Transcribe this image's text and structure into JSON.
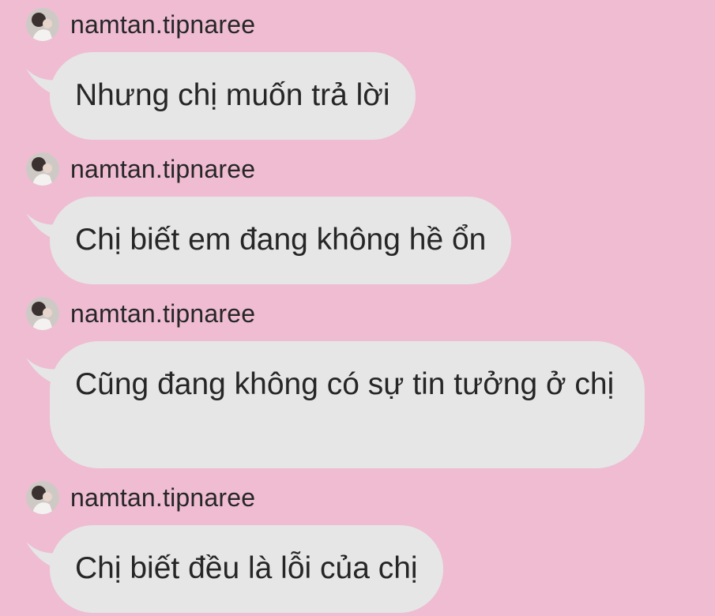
{
  "colors": {
    "background": "#efbcd2",
    "bubble": "#e6e6e6",
    "text": "#262626"
  },
  "messages": [
    {
      "username": "namtan.tipnaree",
      "text": "Nhưng chị muốn trả lời",
      "avatar_icon": "profile-photo-avatar"
    },
    {
      "username": "namtan.tipnaree",
      "text": "Chị biết em đang không hề ổn",
      "avatar_icon": "profile-photo-avatar"
    },
    {
      "username": "namtan.tipnaree",
      "text": "Cũng đang không có sự tin tưởng ở chị",
      "avatar_icon": "profile-photo-avatar"
    },
    {
      "username": "namtan.tipnaree",
      "text": "Chị biết đều là lỗi của chị",
      "avatar_icon": "profile-photo-avatar"
    }
  ]
}
